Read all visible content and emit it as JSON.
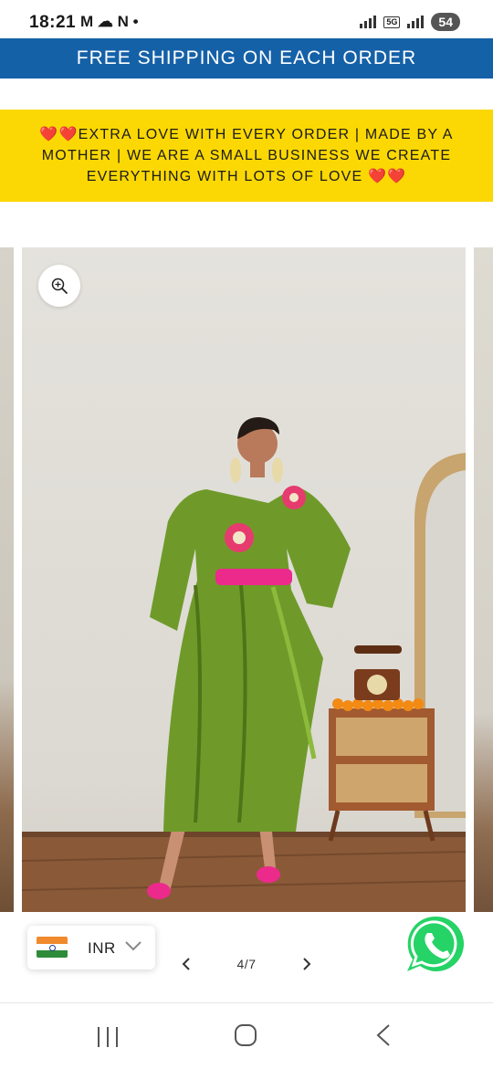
{
  "status_bar": {
    "time": "18:21",
    "notification_icons": "M ☁ N •",
    "network_badge": "5G",
    "battery": "54"
  },
  "shipping_banner": {
    "text": "FREE SHIPPING ON EACH ORDER",
    "background": "#1561a8"
  },
  "love_banner": {
    "text": "❤️❤️EXTRA LOVE WITH EVERY ORDER | MADE BY A MOTHER | WE ARE A SMALL BUSINESS WE CREATE EVERYTHING WITH LOTS OF LOVE ❤️❤️",
    "background": "#fbd803"
  },
  "gallery": {
    "zoom_icon": "zoom-in-icon",
    "image_subject": "product-photo"
  },
  "currency": {
    "flag": "india-flag-icon",
    "code": "INR"
  },
  "pager": {
    "counter": "4/7"
  },
  "whatsapp": {
    "icon": "whatsapp-icon",
    "color": "#25d366"
  },
  "nav_bar": {
    "recents": "recents-icon",
    "home": "home-icon",
    "back": "back-icon"
  }
}
